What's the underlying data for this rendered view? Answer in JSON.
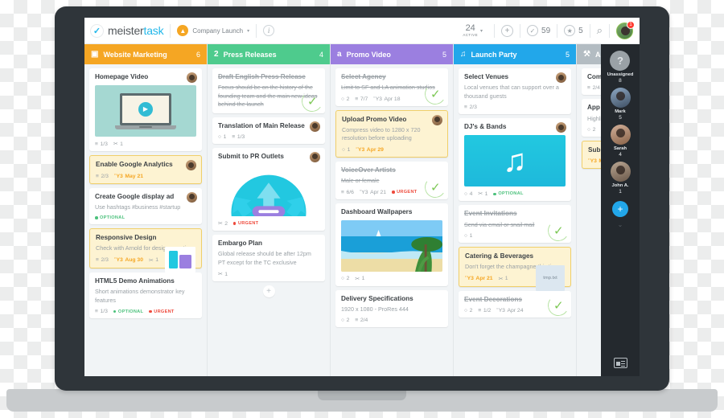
{
  "app": {
    "logo_text_dark": "meister",
    "logo_text_light": "task",
    "logo_icon": "check-icon",
    "project_name": "Company Launch",
    "project_icon": "rocket-icon",
    "caret": "▾",
    "info_icon": "i",
    "accent_blue": "#22b7ea"
  },
  "toolbar": {
    "active_number": "24",
    "active_label": "ACTIVE",
    "active_caret": "▾",
    "add_icon": "+",
    "completed_icon": "✓",
    "completed_count": "59",
    "starred_icon": "★",
    "starred_count": "5",
    "search_icon": "⌕",
    "avatar_badge": "1"
  },
  "columns": [
    {
      "title": "Website Marketing",
      "count": "6",
      "color": "#f5a623",
      "icon": "▣",
      "icon_name": "monitor-icon",
      "cards": [
        {
          "title": "Homepage Video",
          "desc": "",
          "thumb": "video",
          "avatar": true,
          "meta": [
            {
              "icon": "≡",
              "text": "1/3",
              "type": "checklist"
            },
            {
              "icon": "✂",
              "text": "1",
              "type": "attachment"
            }
          ],
          "tags": []
        },
        {
          "title": "Enable Google Analytics",
          "desc": "",
          "highlight": true,
          "avatar": true,
          "meta": [
            {
              "icon": "≡",
              "text": "2/3",
              "type": "checklist"
            },
            {
              "icon": "Ὕ3",
              "text": "May 21",
              "type": "due"
            }
          ],
          "tags": []
        },
        {
          "title": "Create Google display ad",
          "desc": "Use hashtags #business #startup",
          "avatar": true,
          "meta": [],
          "tags": [
            {
              "label": "OPTIONAL",
              "type": "optional"
            }
          ]
        },
        {
          "title": "Responsive Design",
          "desc": "Check with Arnold for design questions",
          "highlight": true,
          "thumb": "devices",
          "meta": [
            {
              "icon": "≡",
              "text": "2/3",
              "type": "checklist"
            },
            {
              "icon": "Ὕ3",
              "text": "Aug 30",
              "type": "due"
            },
            {
              "icon": "✂",
              "text": "1",
              "type": "attachment"
            }
          ],
          "tags": []
        },
        {
          "title": "HTML5 Demo Animations",
          "desc": "Short animations demonstrator key features",
          "meta": [
            {
              "icon": "≡",
              "text": "1/3",
              "type": "checklist"
            }
          ],
          "tags": [
            {
              "label": "OPTIONAL",
              "type": "optional"
            },
            {
              "label": "URGENT",
              "type": "urgent"
            }
          ]
        }
      ]
    },
    {
      "title": "Press Releases",
      "count": "4",
      "color": "#4ecb8d",
      "icon": "὎2",
      "icon_name": "megaphone-icon",
      "cards": [
        {
          "title": "Draft English Press Release",
          "desc": "Focus should be on the history of the founding team and the main new ideas behind the launch",
          "done": true,
          "meta": [],
          "tags": []
        },
        {
          "title": "Translation of Main Release",
          "desc": "",
          "avatar": true,
          "meta": [
            {
              "icon": "○",
              "text": "1",
              "type": "comment"
            },
            {
              "icon": "≡",
              "text": "1/3",
              "type": "checklist"
            }
          ],
          "tags": []
        },
        {
          "title": "Submit to PR Outlets",
          "desc": "",
          "thumb": "arrows",
          "avatar": true,
          "meta": [
            {
              "icon": "✂",
              "text": "2",
              "type": "attachment"
            }
          ],
          "tags": [
            {
              "label": "URGENT",
              "type": "urgent"
            }
          ]
        },
        {
          "title": "Embargo Plan",
          "desc": "Global release should be after 12pm PT except for the TC exclusive",
          "meta": [
            {
              "icon": "✂",
              "text": "1",
              "type": "attachment"
            }
          ],
          "tags": []
        }
      ],
      "add_card_icon": "+"
    },
    {
      "title": "Promo Video",
      "count": "5",
      "color": "#9b7fe0",
      "icon": "὏a",
      "icon_name": "tv-icon",
      "cards": [
        {
          "title": "Select Agency",
          "desc": "Limit to SF and LA animation studios",
          "done": true,
          "meta": [
            {
              "icon": "○",
              "text": "2",
              "type": "comment"
            },
            {
              "icon": "≡",
              "text": "7/7",
              "type": "checklist"
            },
            {
              "icon": "Ὕ3",
              "text": "Apr 18",
              "type": "date"
            }
          ],
          "tags": []
        },
        {
          "title": "Upload Promo Video",
          "desc": "Compress video to 1280 x 720 resolution before uploading",
          "highlight": true,
          "avatar": true,
          "meta": [
            {
              "icon": "○",
              "text": "1",
              "type": "comment"
            },
            {
              "icon": "Ὕ3",
              "text": "Apr 29",
              "type": "due"
            }
          ],
          "tags": []
        },
        {
          "title": "VoiceOver Artists",
          "desc": "Male or female",
          "done": true,
          "meta": [
            {
              "icon": "≡",
              "text": "6/6",
              "type": "checklist"
            },
            {
              "icon": "Ὕ3",
              "text": "Apr 21",
              "type": "date"
            }
          ],
          "tags": [
            {
              "label": "URGENT",
              "type": "urgent"
            }
          ]
        },
        {
          "title": "Dashboard Wallpapers",
          "desc": "",
          "thumb": "beach",
          "meta": [
            {
              "icon": "○",
              "text": "2",
              "type": "comment"
            },
            {
              "icon": "✂",
              "text": "1",
              "type": "attachment"
            }
          ],
          "tags": []
        },
        {
          "title": "Delivery Specifications",
          "desc": "1920 x 1080 - ProRes 444",
          "meta": [
            {
              "icon": "○",
              "text": "2",
              "type": "comment"
            },
            {
              "icon": "≡",
              "text": "2/4",
              "type": "checklist"
            }
          ],
          "tags": []
        }
      ]
    },
    {
      "title": "Launch Party",
      "count": "5",
      "color": "#22a7ea",
      "icon": "♫",
      "icon_name": "music-note-icon",
      "cards": [
        {
          "title": "Select Venues",
          "desc": "Local venues that can support over a thousand guests",
          "avatar": true,
          "meta": [
            {
              "icon": "≡",
              "text": "2/3",
              "type": "checklist"
            }
          ],
          "tags": []
        },
        {
          "title": "DJ's & Bands",
          "desc": "",
          "thumb": "music",
          "avatar": true,
          "meta": [
            {
              "icon": "○",
              "text": "4",
              "type": "comment"
            },
            {
              "icon": "✂",
              "text": "1",
              "type": "attachment"
            }
          ],
          "tags": [
            {
              "label": "OPTIONAL",
              "type": "optional"
            }
          ]
        },
        {
          "title": "Event Invitations",
          "desc": "Send via email or snail mail",
          "done": true,
          "meta": [
            {
              "icon": "○",
              "text": "1",
              "type": "comment"
            }
          ],
          "tags": []
        },
        {
          "title": "Catering & Beverages",
          "desc": "Don't forget the champagne this time",
          "highlight": true,
          "file_label": "tmp.txt",
          "meta": [
            {
              "icon": "Ὕ3",
              "text": "Apr 21",
              "type": "due"
            },
            {
              "icon": "✂",
              "text": "1",
              "type": "attachment"
            }
          ],
          "tags": []
        },
        {
          "title": "Event Decorations",
          "desc": "",
          "done": true,
          "meta": [
            {
              "icon": "○",
              "text": "2",
              "type": "comment"
            },
            {
              "icon": "≡",
              "text": "1/2",
              "type": "checklist"
            },
            {
              "icon": "Ὕ3",
              "text": "Apr 24",
              "type": "date"
            }
          ],
          "tags": []
        }
      ]
    },
    {
      "title": "Ap",
      "count": "",
      "color": "#b3bcc2",
      "icon": "⚒",
      "icon_name": "tools-icon",
      "cards": [
        {
          "title": "Compil",
          "desc": "",
          "meta": [
            {
              "icon": "≡",
              "text": "2/4",
              "type": "checklist"
            }
          ],
          "tags": []
        },
        {
          "title": "App sc",
          "desc": "Highligh",
          "meta": [
            {
              "icon": "○",
              "text": "2",
              "type": "comment"
            }
          ],
          "tags": []
        },
        {
          "title": "Submit",
          "desc": "",
          "highlight": true,
          "meta": [
            {
              "icon": "Ὕ3",
              "text": "May",
              "type": "due"
            }
          ],
          "tags": []
        }
      ]
    }
  ],
  "member_sidebar": {
    "members": [
      {
        "name": "Unassigned",
        "count": "8",
        "avatar": "question"
      },
      {
        "name": "Mark",
        "count": "5",
        "avatar": "p1"
      },
      {
        "name": "Sarah",
        "count": "4",
        "avatar": "p2"
      },
      {
        "name": "John A.",
        "count": "1",
        "avatar": "p3"
      }
    ],
    "question_glyph": "?",
    "add_icon": "+",
    "chevron": "⌄",
    "panel_toggle_name": "panel-toggle-icon"
  }
}
